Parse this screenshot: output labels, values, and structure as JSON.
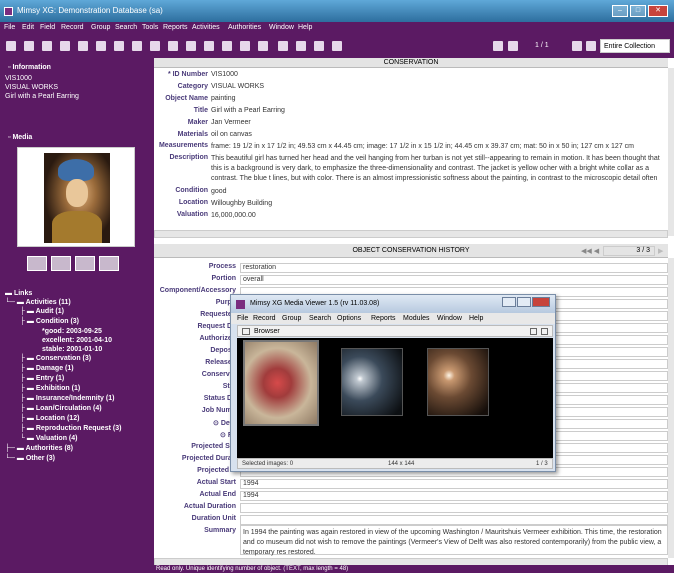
{
  "window": {
    "title": "Mimsy XG: Demonstration Database (sa)"
  },
  "menu": [
    "File",
    "Edit",
    "Field",
    "Record",
    "Group",
    "Search",
    "Tools",
    "Reports",
    "Activities",
    "Authorities",
    "Window",
    "Help"
  ],
  "toolbar": {
    "page_indicator": "1 / 1",
    "collection": "Entire Collection"
  },
  "sidebar": {
    "info_header": "Information",
    "info_lines": [
      "VIS1000",
      "VISUAL WORKS",
      "Girl with a Pearl Earring"
    ],
    "media_header": "Media",
    "links_header": "Links",
    "tree": [
      "Activities (11)",
      "Audit (1)",
      "Condition (3)",
      "*good: 2003-09-25",
      "excellent: 2001-04-10",
      "stable: 2001-01-10",
      "Conservation (3)",
      "Damage (1)",
      "Entry (1)",
      "Exhibition (1)",
      "Insurance/Indemnity (1)",
      "Loan/Circulation (4)",
      "Location (12)",
      "Reproduction Request (3)",
      "Valuation (4)",
      "Authorities (8)",
      "Other (3)"
    ]
  },
  "conservation": {
    "header": "CONSERVATION",
    "fields": [
      {
        "label": "* ID Number",
        "value": "VIS1000"
      },
      {
        "label": "Category",
        "value": "VISUAL WORKS"
      },
      {
        "label": "Object Name",
        "value": "painting"
      },
      {
        "label": "Title",
        "value": "Girl with a Pearl Earring"
      },
      {
        "label": "Maker",
        "value": "Jan Vermeer"
      },
      {
        "label": "Materials",
        "value": "oil on canvas"
      },
      {
        "label": "Measurements",
        "value": "frame: 19 1/2 in x 17 1/2 in; 49.53 cm x 44.45 cm; image: 17 1/2 in x 15 1/2 in; 44.45 cm x 39.37 cm; mat: 50 in x 50 in; 127 cm x 127 cm"
      },
      {
        "label": "Description",
        "value": "This beautiful girl has turned her head and the veil hanging from her turban is not yet still--appearing to remain in motion. It has been thought that this is a background is very dark, to emphasize the three-dimensionality and contrast. The jacket is yellow ocher with a bright white collar as a contrast. The blue t lines, but with color. There is an almost impressionistic softness about the painting, in contrast to the microscopic detail often seen in the paintings of Verm"
      },
      {
        "label": "Condition",
        "value": "good"
      },
      {
        "label": "Location",
        "value": "Willoughby Building"
      },
      {
        "label": "Valuation",
        "value": "16,000,000.00"
      }
    ]
  },
  "history": {
    "header": "OBJECT CONSERVATION HISTORY",
    "pager": "3 / 3",
    "fields": [
      {
        "label": "Process",
        "value": "restoration"
      },
      {
        "label": "Portion",
        "value": "overall"
      },
      {
        "label": "Component/Accessory",
        "value": ""
      },
      {
        "label": "Purpo",
        "value": ""
      },
      {
        "label": "Requested",
        "value": ""
      },
      {
        "label": "Request Da",
        "value": ""
      },
      {
        "label": "Authorized",
        "value": ""
      },
      {
        "label": "Deposit",
        "value": ""
      },
      {
        "label": "Released",
        "value": ""
      },
      {
        "label": "Conservat",
        "value": ""
      },
      {
        "label": "Stat",
        "value": ""
      },
      {
        "label": "Status Da",
        "value": ""
      },
      {
        "label": "Job Numb",
        "value": ""
      },
      {
        "label": "⊙ Deta",
        "value": ""
      },
      {
        "label": "⊙ Fe",
        "value": ""
      },
      {
        "label": "Projected Sta",
        "value": ""
      },
      {
        "label": "Projected Durati",
        "value": ""
      },
      {
        "label": "Projected U",
        "value": ""
      },
      {
        "label": "Actual Start",
        "value": "1994"
      },
      {
        "label": "Actual End",
        "value": "1994"
      },
      {
        "label": "Actual Duration",
        "value": ""
      },
      {
        "label": "Duration Unit",
        "value": ""
      }
    ],
    "summary_label": "Summary",
    "summary": "In 1994 the painting was again restored in view of the upcoming Washington / Mauritshuis Vermeer exhibition. This time, the restoration and co museum did not wish to remove the paintings (Vermeer's View of Delft was also restored contemporarily) from the public view, a temporary res restored."
  },
  "status": "Read only. Unique identifying number of object. (TEXT, max length = 48)",
  "media_viewer": {
    "title": "Mimsy XG Media Viewer 1.5 (rv 11.03.08)",
    "menu": [
      "File",
      "Record",
      "Group",
      "Search",
      "Options",
      "Reports",
      "Modules",
      "Window",
      "Help"
    ],
    "panel": "Browser",
    "status_left": "Selected images: 0",
    "status_mid": "144 x 144",
    "status_right": "1 / 3"
  }
}
